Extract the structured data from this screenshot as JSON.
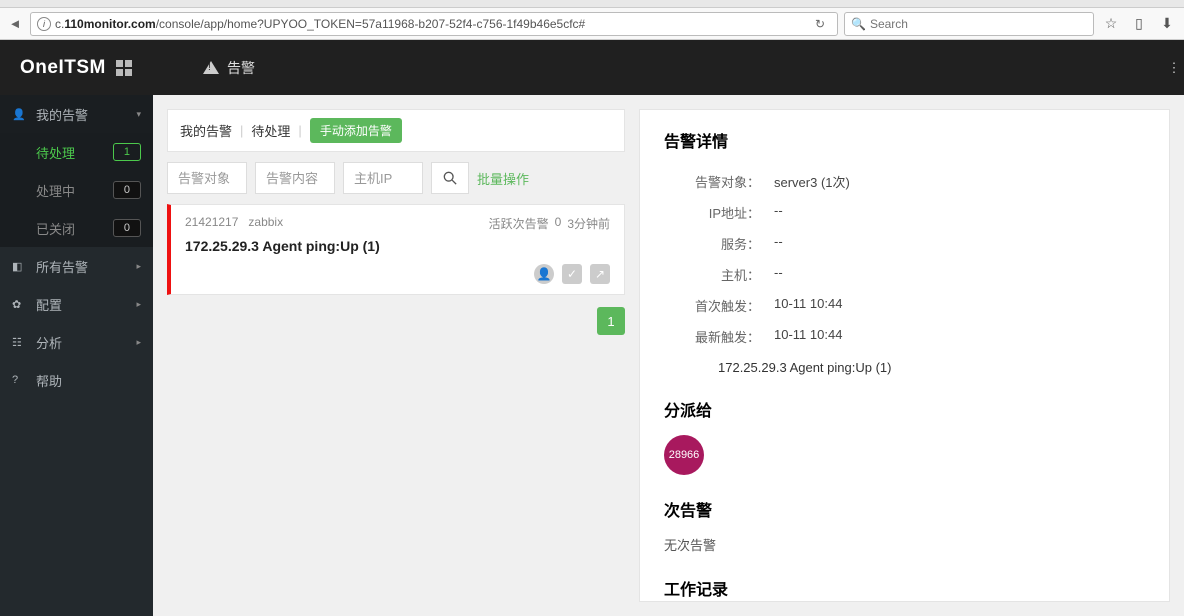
{
  "browser": {
    "url_prefix": "c.",
    "url_domain": "110monitor.com",
    "url_path": "/console/app/home?UPYOO_TOKEN=57a11968-b207-52f4-c756-1f49b46e5cfc#",
    "search_placeholder": "Search"
  },
  "header": {
    "logo": "OneITSM",
    "section": "告警"
  },
  "sidebar": {
    "my_alarms": "我的告警",
    "items": [
      {
        "label": "待处理",
        "count": "1",
        "active": true
      },
      {
        "label": "处理中",
        "count": "0",
        "active": false
      },
      {
        "label": "已关闭",
        "count": "0",
        "active": false
      }
    ],
    "nav": [
      {
        "label": "所有告警"
      },
      {
        "label": "配置"
      },
      {
        "label": "分析"
      },
      {
        "label": "帮助"
      }
    ]
  },
  "breadcrumb": {
    "a": "我的告警",
    "b": "待处理",
    "btn": "手动添加告警"
  },
  "filters": {
    "f1": "告警对象",
    "f2": "告警内容",
    "f3": "主机IP",
    "batch": "批量操作"
  },
  "alarm": {
    "id": "21421217",
    "source": "zabbix",
    "active_label": "活跃次告警",
    "active_count": "0",
    "time": "3分钟前",
    "title": "172.25.29.3 Agent ping:Up (1)"
  },
  "pagination": {
    "current": "1"
  },
  "detail": {
    "title": "告警详情",
    "rows": {
      "target_lbl": "告警对象：",
      "target_val": "server3 (1次)",
      "ip_lbl": "IP地址：",
      "ip_val": "--",
      "service_lbl": "服务：",
      "service_val": "--",
      "host_lbl": "主机：",
      "host_val": "--",
      "first_lbl": "首次触发：",
      "first_val": "10-11 10:44",
      "last_lbl": "最新触发：",
      "last_val": "10-11 10:44"
    },
    "message": "172.25.29.3 Agent ping:Up (1)",
    "assign_title": "分派给",
    "assign_id": "28966",
    "sub_title": "次告警",
    "sub_none": "无次告警",
    "log_title": "工作记录"
  }
}
